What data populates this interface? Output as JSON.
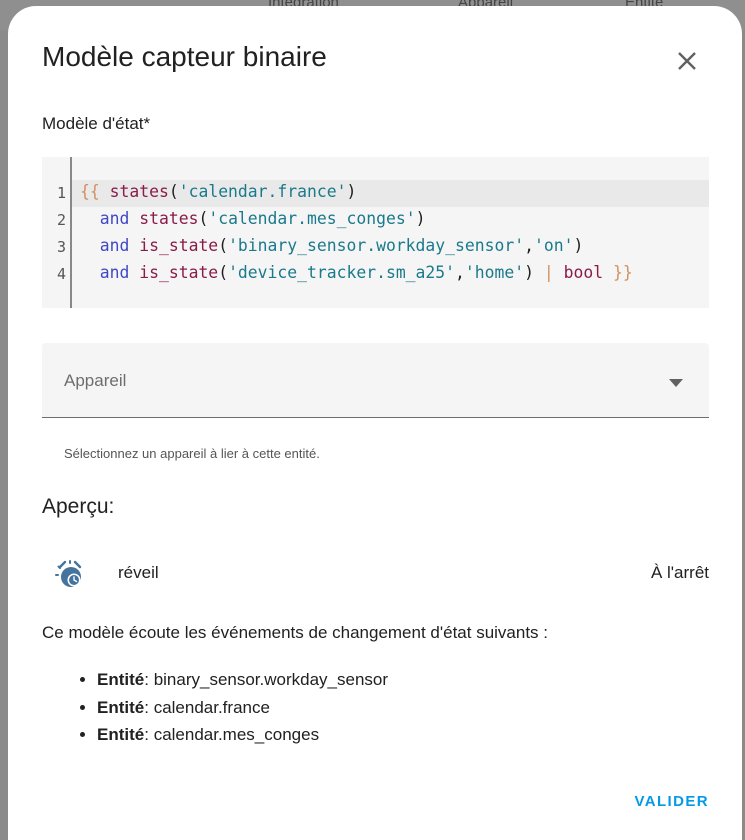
{
  "backdrop": {
    "col1": "Intégration",
    "col2": "Appareil",
    "col3": "Entité"
  },
  "dialog": {
    "title": "Modèle capteur binaire"
  },
  "template_field": {
    "label": "Modèle d'état*",
    "lines": [
      "{{ states('calendar.france')",
      "  and states('calendar.mes_conges')",
      "  and is_state('binary_sensor.workday_sensor','on')",
      "  and is_state('device_tracker.sm_a25','home') | bool }}"
    ],
    "line_numbers": [
      "1",
      "2",
      "3",
      "4"
    ]
  },
  "device_select": {
    "placeholder": "Appareil",
    "helper": "Sélectionnez un appareil à lier à cette entité."
  },
  "preview": {
    "heading": "Aperçu:",
    "entity_icon": "alarm-clock-icon",
    "entity_name": "réveil",
    "entity_state": "À l'arrêt"
  },
  "listeners": {
    "intro": "Ce modèle écoute les événements de changement d'état suivants :",
    "entity_label": "Entité",
    "entities": [
      "binary_sensor.workday_sensor",
      "calendar.france",
      "calendar.mes_conges"
    ]
  },
  "actions": {
    "confirm": "VALIDER"
  },
  "colors": {
    "accent": "#039be5",
    "icon": "#44739e"
  }
}
